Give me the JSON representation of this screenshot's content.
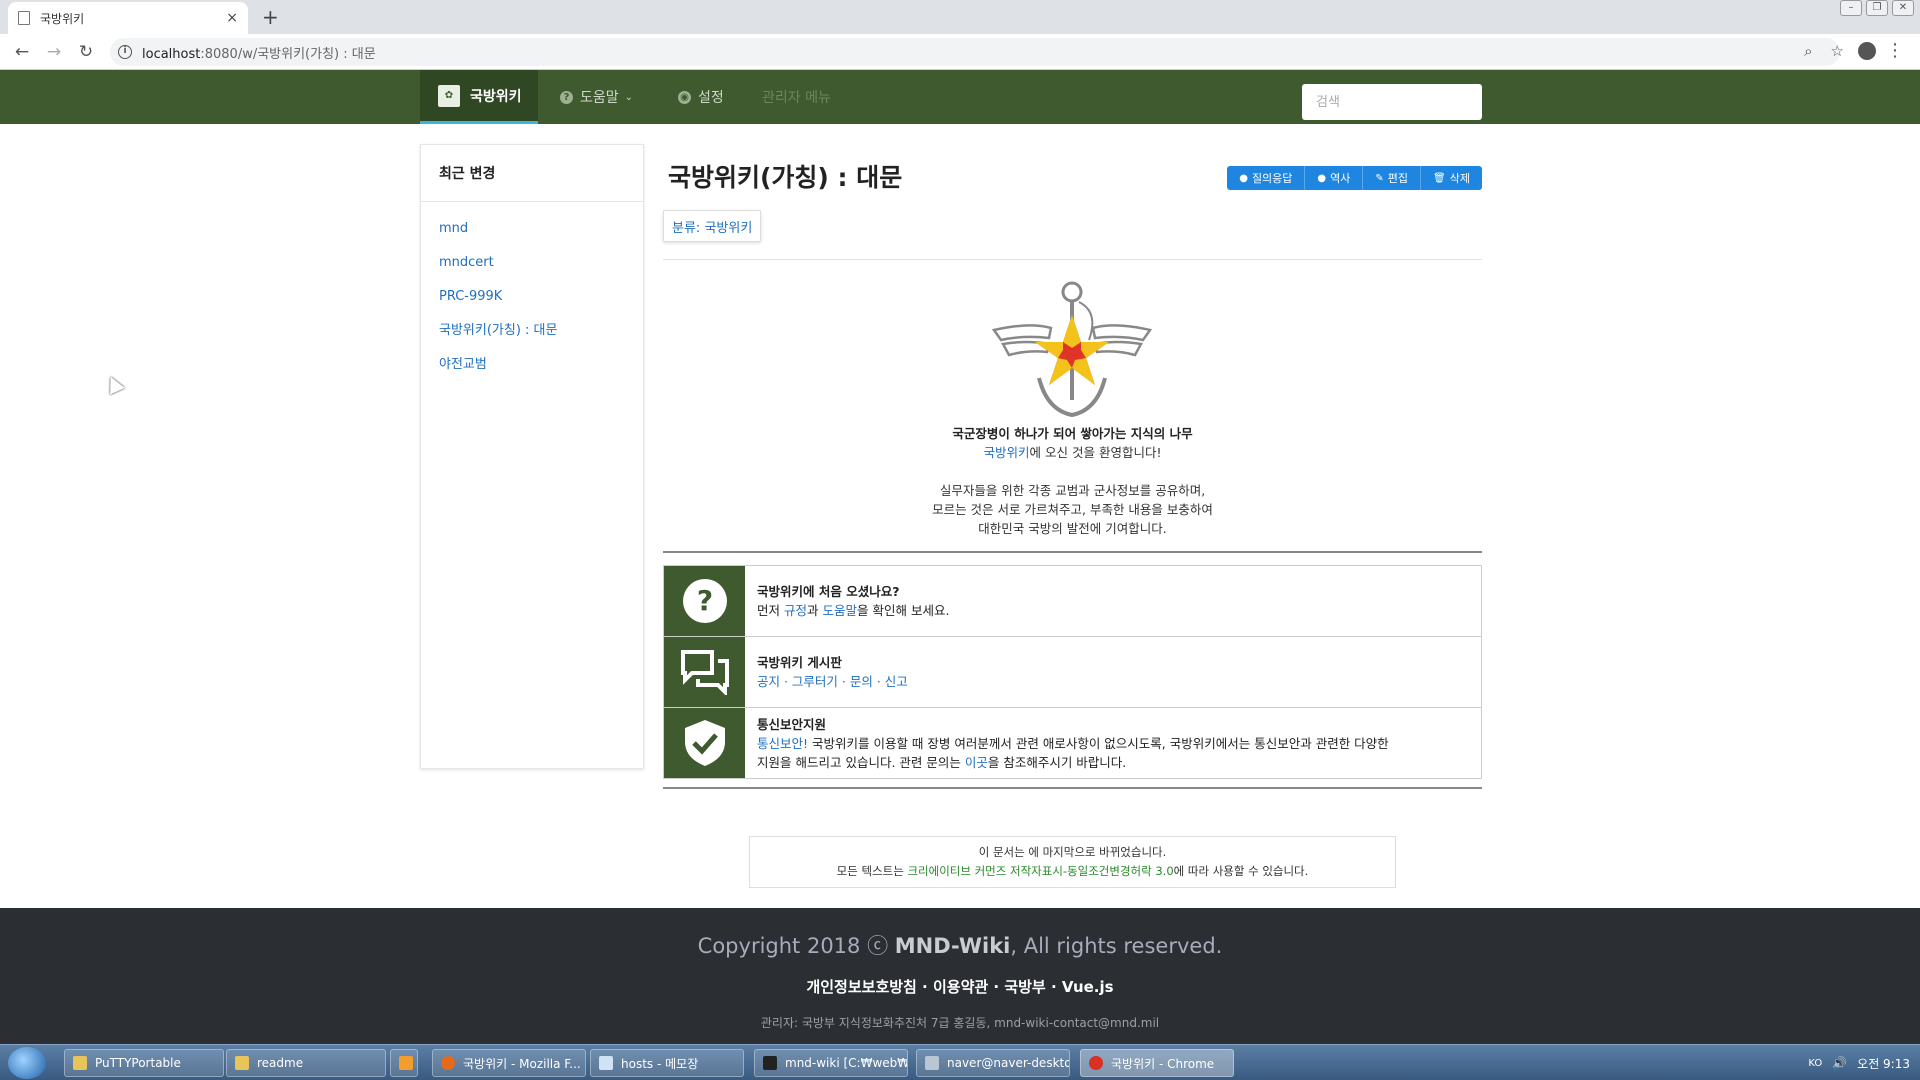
{
  "browser": {
    "tab_title": "국방위키",
    "tab_close": "×",
    "new_tab": "+",
    "url_host": "localhost",
    "url_rest": ":8080/w/국방위키(가칭) : 대문",
    "window_controls": [
      "–",
      "❐",
      "✕"
    ]
  },
  "navbar": {
    "brand_label": "국방위키",
    "help_label": "도움말",
    "settings_label": "설정",
    "admin_label": "관리자 메뉴",
    "search_placeholder": "검색"
  },
  "sidebar": {
    "title": "최근 변경",
    "items": [
      {
        "label": "mnd"
      },
      {
        "label": "mndcert"
      },
      {
        "label": "PRC-999K"
      },
      {
        "label": "국방위키(가칭) : 대문"
      },
      {
        "label": "야전교범"
      }
    ]
  },
  "page": {
    "title": "국방위키(가칭) : 대문",
    "actions": [
      {
        "label": "질의응답",
        "icon": "question-icon"
      },
      {
        "label": "역사",
        "icon": "info-icon"
      },
      {
        "label": "편집",
        "icon": "pencil-icon"
      },
      {
        "label": "삭제",
        "icon": "trash-icon"
      }
    ],
    "category_prefix": "분류:",
    "category_link": "국방위키"
  },
  "intro": {
    "slogan": "국군장병이 하나가 되어 쌓아가는 지식의 나무",
    "welcome_link": "국방위키",
    "welcome_rest": "에 오신 것을 환영합니다!",
    "line1": "실무자들을 위한 각종 교범과 군사정보를 공유하며,",
    "line2": "모르는 것은 서로 가르쳐주고, 부족한 내용을 보충하여",
    "line3": "대한민국 국방의 발전에 기여합니다."
  },
  "portal": {
    "row1": {
      "icon": "question-circle-icon",
      "title": "국방위키에 처음 오셨나요?",
      "pre": "먼저 ",
      "link1": "규정",
      "mid": "과 ",
      "link2": "도움말",
      "post": "을 확인해 보세요."
    },
    "row2": {
      "icon": "chat-bubbles-icon",
      "title": "국방위키 게시판",
      "links": "공지 · 그루터기 · 문의 · 신고"
    },
    "row3": {
      "icon": "shield-check-icon",
      "title": "통신보안지원",
      "link1": "통신보안!",
      "text1": " 국방위키를 이용할 때 장병 여러분께서 관련 애로사항이 없으시도록, 국방위키에서는 통신보안과 관련한 다양한",
      "text2": "지원을 해드리고 있습니다. 관련 문의는 ",
      "link2": "이곳",
      "text3": "을 참조해주시기 바랍니다."
    }
  },
  "license": {
    "line1": "이 문서는 에 마지막으로 바뀌었습니다.",
    "pre": "모든 텍스트는 ",
    "link": "크리에이티브 커먼즈 저작자표시-동일조건변경허락 3.0",
    "post": "에 따라 사용할 수 있습니다."
  },
  "footer": {
    "copy_pre": "Copyright 2018 ⓒ ",
    "copy_brand": "MND-Wiki",
    "copy_post": ", All rights reserved.",
    "links": "개인정보보호방침 · 이용약관 · 국방부 · Vue.js",
    "admin": "관리자: 국방부 지식정보화추진처 7급 홍길동, mnd-wiki-contact@mnd.mil"
  },
  "taskbar": {
    "items": [
      {
        "label": "PuTTYPortable"
      },
      {
        "label": "readme"
      },
      {
        "label": ""
      },
      {
        "label": "국방위키 - Mozilla F..."
      },
      {
        "label": "hosts - 메모장"
      },
      {
        "label": "mnd-wiki [C:₩web₩..."
      },
      {
        "label": "naver@naver-deskto..."
      },
      {
        "label": "국방위키 - Chrome"
      }
    ],
    "lang": "KO",
    "clock": "오전 9:13"
  }
}
